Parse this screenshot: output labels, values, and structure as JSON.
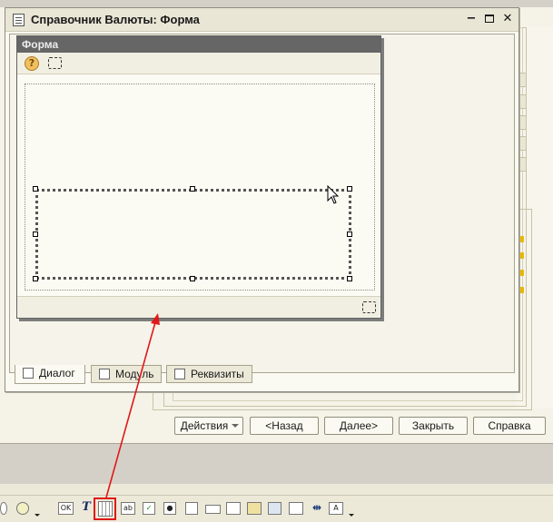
{
  "window": {
    "title": "Справочник Валюты: Форма"
  },
  "form": {
    "title": "Форма"
  },
  "tabs": [
    {
      "label": "Диалог",
      "active": true
    },
    {
      "label": "Модуль",
      "active": false
    },
    {
      "label": "Реквизиты",
      "active": false
    }
  ],
  "buttons": {
    "actions": "Действия",
    "back": "<Назад",
    "next": "Далее>",
    "close": "Закрыть",
    "help": "Справка"
  },
  "toolbar": {
    "ok_label": "OK",
    "text_label": "T",
    "ab_label": "ab",
    "highlighted_tool": "table-control-icon"
  },
  "icons": {
    "help": "question-icon",
    "select": "selection-icon",
    "cursor": "mouse-pointer-icon"
  },
  "colors": {
    "annotation": "#e01818",
    "form_title_bar": "#666666",
    "workspace": "#fbfaf2"
  }
}
